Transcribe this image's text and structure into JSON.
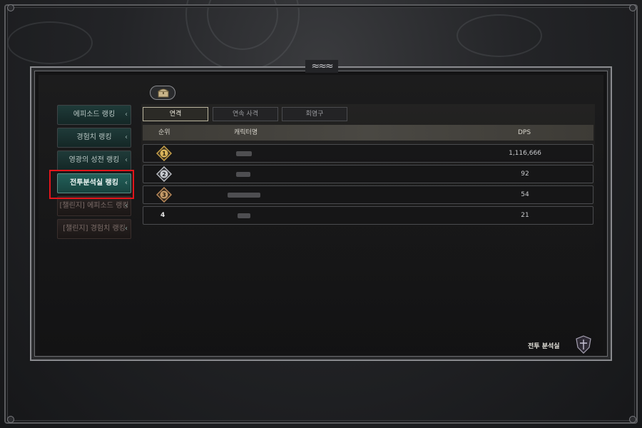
{
  "sidebar": {
    "items": [
      {
        "label": "에피소드 랭킹",
        "state": "normal"
      },
      {
        "label": "경험치 랭킹",
        "state": "normal"
      },
      {
        "label": "영광의 성전 랭킹",
        "state": "normal"
      },
      {
        "label": "전투분석실 랭킹",
        "state": "active"
      },
      {
        "label": "[챌린지] 에피소드 랭킹",
        "state": "dim"
      },
      {
        "label": "[챌린지] 경험치 랭킹",
        "state": "dim"
      }
    ]
  },
  "tabs": [
    {
      "label": "연격",
      "active": true
    },
    {
      "label": "연속 사격",
      "active": false
    },
    {
      "label": "회염구",
      "active": false
    }
  ],
  "table": {
    "headers": {
      "rank": "순위",
      "name": "캐릭터명",
      "dps": "DPS"
    },
    "rows": [
      {
        "rank": "1",
        "dps": "1,116,666"
      },
      {
        "rank": "2",
        "dps": "92"
      },
      {
        "rank": "3",
        "dps": "54"
      },
      {
        "rank": "4",
        "dps": "21"
      }
    ]
  },
  "footer": {
    "label": "전투 분석실"
  },
  "colors": {
    "highlight": "#e3151b",
    "active_tab_border": "#b9b49e",
    "sidebar_active": "#23605a"
  },
  "icons": {
    "top": "treasure-chest-icon",
    "footer": "shield-emblem-icon"
  }
}
